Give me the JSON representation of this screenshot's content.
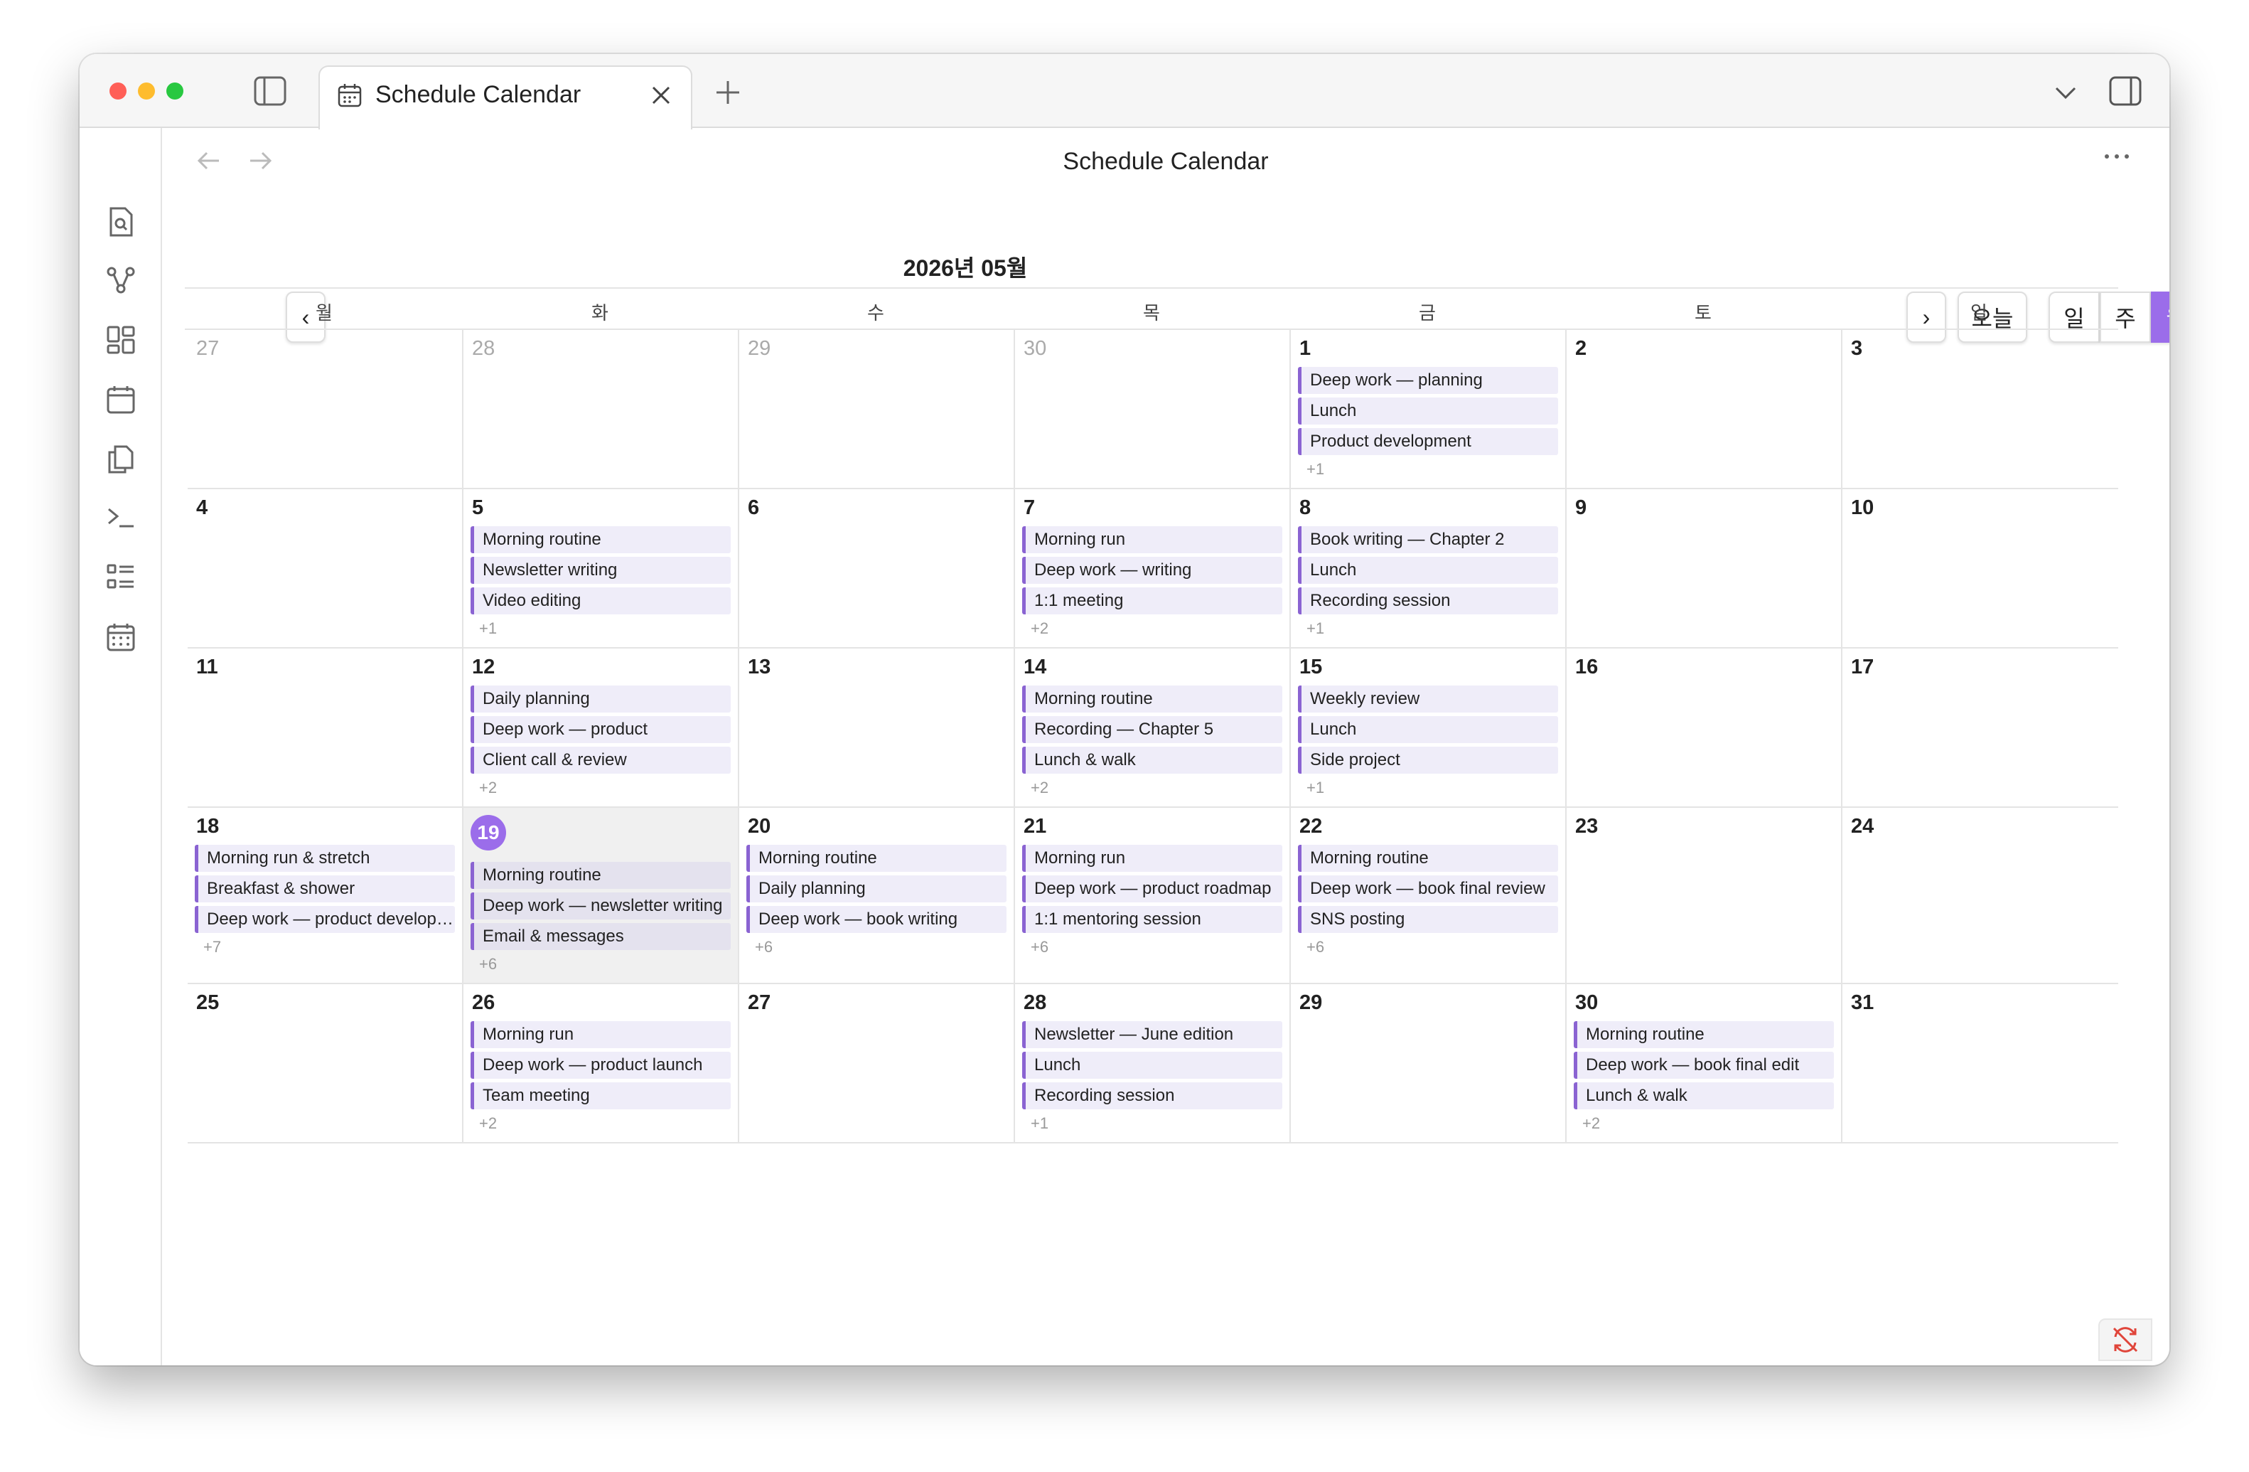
{
  "tab": {
    "title": "Schedule Calendar"
  },
  "page": {
    "title": "Schedule Calendar"
  },
  "calendar": {
    "month_title": "2026년 05월",
    "today_label": "오늘",
    "prev_label": "‹",
    "next_label": "›",
    "views": [
      "일",
      "주",
      "월"
    ],
    "active_view": "월",
    "weekdays": [
      "월",
      "화",
      "수",
      "목",
      "금",
      "토",
      "일"
    ],
    "accent_color": "#9b6dea",
    "weeks": [
      [
        {
          "day": "27",
          "muted": true,
          "events": []
        },
        {
          "day": "28",
          "muted": true,
          "events": []
        },
        {
          "day": "29",
          "muted": true,
          "events": []
        },
        {
          "day": "30",
          "muted": true,
          "events": []
        },
        {
          "day": "1",
          "events": [
            "Deep work — planning",
            "Lunch",
            "Product development"
          ],
          "more": "+1"
        },
        {
          "day": "2",
          "events": []
        },
        {
          "day": "3",
          "events": []
        }
      ],
      [
        {
          "day": "4",
          "events": []
        },
        {
          "day": "5",
          "events": [
            "Morning routine",
            "Newsletter writing",
            "Video editing"
          ],
          "more": "+1"
        },
        {
          "day": "6",
          "events": []
        },
        {
          "day": "7",
          "events": [
            "Morning run",
            "Deep work — writing",
            "1:1 meeting"
          ],
          "more": "+2"
        },
        {
          "day": "8",
          "events": [
            "Book writing — Chapter 2",
            "Lunch",
            "Recording session"
          ],
          "more": "+1"
        },
        {
          "day": "9",
          "events": []
        },
        {
          "day": "10",
          "events": []
        }
      ],
      [
        {
          "day": "11",
          "events": []
        },
        {
          "day": "12",
          "events": [
            "Daily planning",
            "Deep work — product",
            "Client call & review"
          ],
          "more": "+2"
        },
        {
          "day": "13",
          "events": []
        },
        {
          "day": "14",
          "events": [
            "Morning routine",
            "Recording — Chapter 5",
            "Lunch & walk"
          ],
          "more": "+2"
        },
        {
          "day": "15",
          "events": [
            "Weekly review",
            "Lunch",
            "Side project"
          ],
          "more": "+1"
        },
        {
          "day": "16",
          "events": []
        },
        {
          "day": "17",
          "events": []
        }
      ],
      [
        {
          "day": "18",
          "events": [
            "Morning run & stretch",
            "Breakfast & shower",
            "Deep work — product development"
          ],
          "more": "+7"
        },
        {
          "day": "19",
          "today": true,
          "events": [
            "Morning routine",
            "Deep work — newsletter writing",
            "Email & messages"
          ],
          "more": "+6"
        },
        {
          "day": "20",
          "events": [
            "Morning routine",
            "Daily planning",
            "Deep work — book writing"
          ],
          "more": "+6"
        },
        {
          "day": "21",
          "events": [
            "Morning run",
            "Deep work — product roadmap",
            "1:1 mentoring session"
          ],
          "more": "+6"
        },
        {
          "day": "22",
          "events": [
            "Morning routine",
            "Deep work — book final review",
            "SNS posting"
          ],
          "more": "+6"
        },
        {
          "day": "23",
          "events": []
        },
        {
          "day": "24",
          "events": []
        }
      ],
      [
        {
          "day": "25",
          "events": []
        },
        {
          "day": "26",
          "events": [
            "Morning run",
            "Deep work — product launch",
            "Team meeting"
          ],
          "more": "+2"
        },
        {
          "day": "27",
          "events": []
        },
        {
          "day": "28",
          "events": [
            "Newsletter — June edition",
            "Lunch",
            "Recording session"
          ],
          "more": "+1"
        },
        {
          "day": "29",
          "events": []
        },
        {
          "day": "30",
          "events": [
            "Morning routine",
            "Deep work — book final edit",
            "Lunch & walk"
          ],
          "more": "+2"
        },
        {
          "day": "31",
          "events": []
        }
      ]
    ]
  },
  "sidebar": {
    "icons": [
      "search-file-icon",
      "graph-icon",
      "dashboard-icon",
      "calendar-icon",
      "copy-icon",
      "terminal-icon",
      "list-icon",
      "calendar-grid-icon"
    ]
  }
}
